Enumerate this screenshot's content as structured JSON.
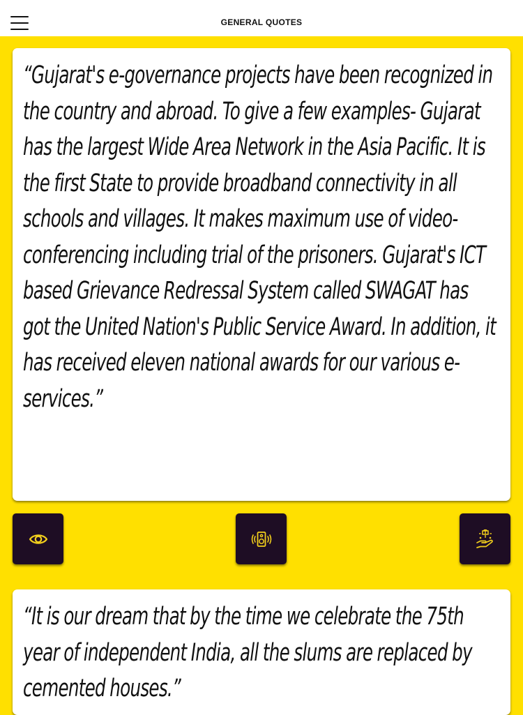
{
  "header": {
    "title": "GENERAL QUOTES",
    "menu_icon": "hamburger-menu-icon"
  },
  "quotes": [
    {
      "text": "“Gujarat's e-governance projects have been recognized in the country and abroad. To give a few examples- Gujarat has the largest Wide Area Network in the Asia Pacific. It is the first State to provide broadband connectivity in all schools and villages. It makes maximum use of video-conferencing including trial of the prisoners. Gujarat's ICT based Grievance Redressal System called SWAGAT has got the United Nation's Public Service Award. In addition, it has received eleven national awards for our various e-services.”"
    },
    {
      "text": "“It is our dream that by the time we celebrate the 75th year of independent India, all the slums are replaced by cemented houses.”"
    }
  ],
  "actions": [
    {
      "name": "view-button",
      "icon": "eye-icon"
    },
    {
      "name": "speaker-button",
      "icon": "speaker-icon"
    },
    {
      "name": "share-button",
      "icon": "hand-gift-icon"
    }
  ],
  "colors": {
    "background": "#ffe000",
    "header_bg": "#ffffff",
    "card_bg": "#ffffff",
    "button_bg": "#1e0d24",
    "icon_accent": "#f2cf1c",
    "text": "#111111"
  }
}
